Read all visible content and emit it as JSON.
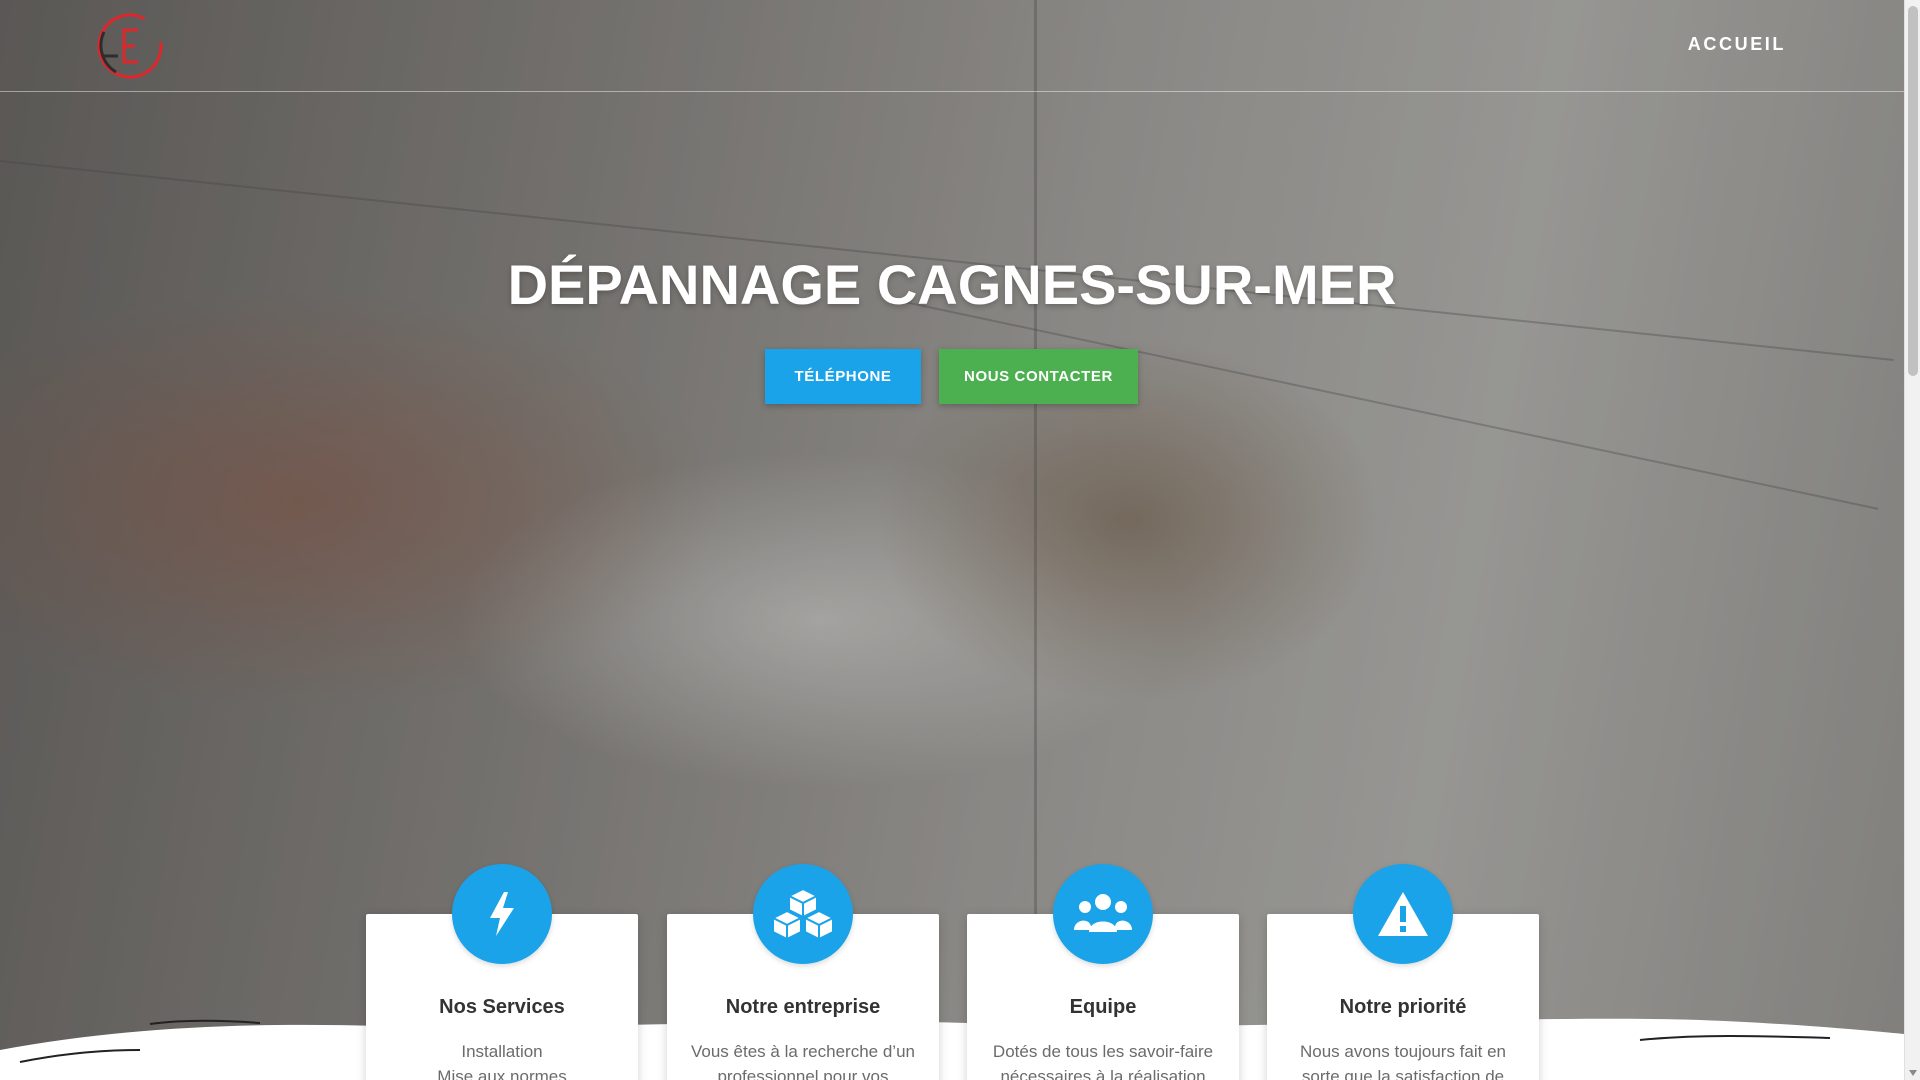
{
  "nav": {
    "links": [
      "ACCUEIL"
    ]
  },
  "hero": {
    "title": "DÉPANNAGE CAGNES-SUR-MER",
    "buttons": {
      "phone": "TÉLÉPHONE",
      "contact": "NOUS CONTACTER"
    }
  },
  "cards": [
    {
      "icon": "lightning-icon",
      "title": "Nos Services",
      "text_lines": [
        "Installation",
        "Mise aux normes"
      ]
    },
    {
      "icon": "cubes-icon",
      "title": "Notre entreprise",
      "text_lines": [
        "Vous êtes à la recherche d’un",
        "professionnel pour vos"
      ]
    },
    {
      "icon": "users-icon",
      "title": "Equipe",
      "text_lines": [
        "Dotés de tous les savoir-faire",
        "nécessaires à la réalisation de"
      ]
    },
    {
      "icon": "warning-icon",
      "title": "Notre priorité",
      "text_lines": [
        "Nous avons toujours fait en",
        "sorte que la satisfaction de"
      ]
    }
  ],
  "colors": {
    "primary_blue": "#1aa3e8",
    "contact_green": "#4caf50",
    "logo_red": "#e0262b"
  }
}
